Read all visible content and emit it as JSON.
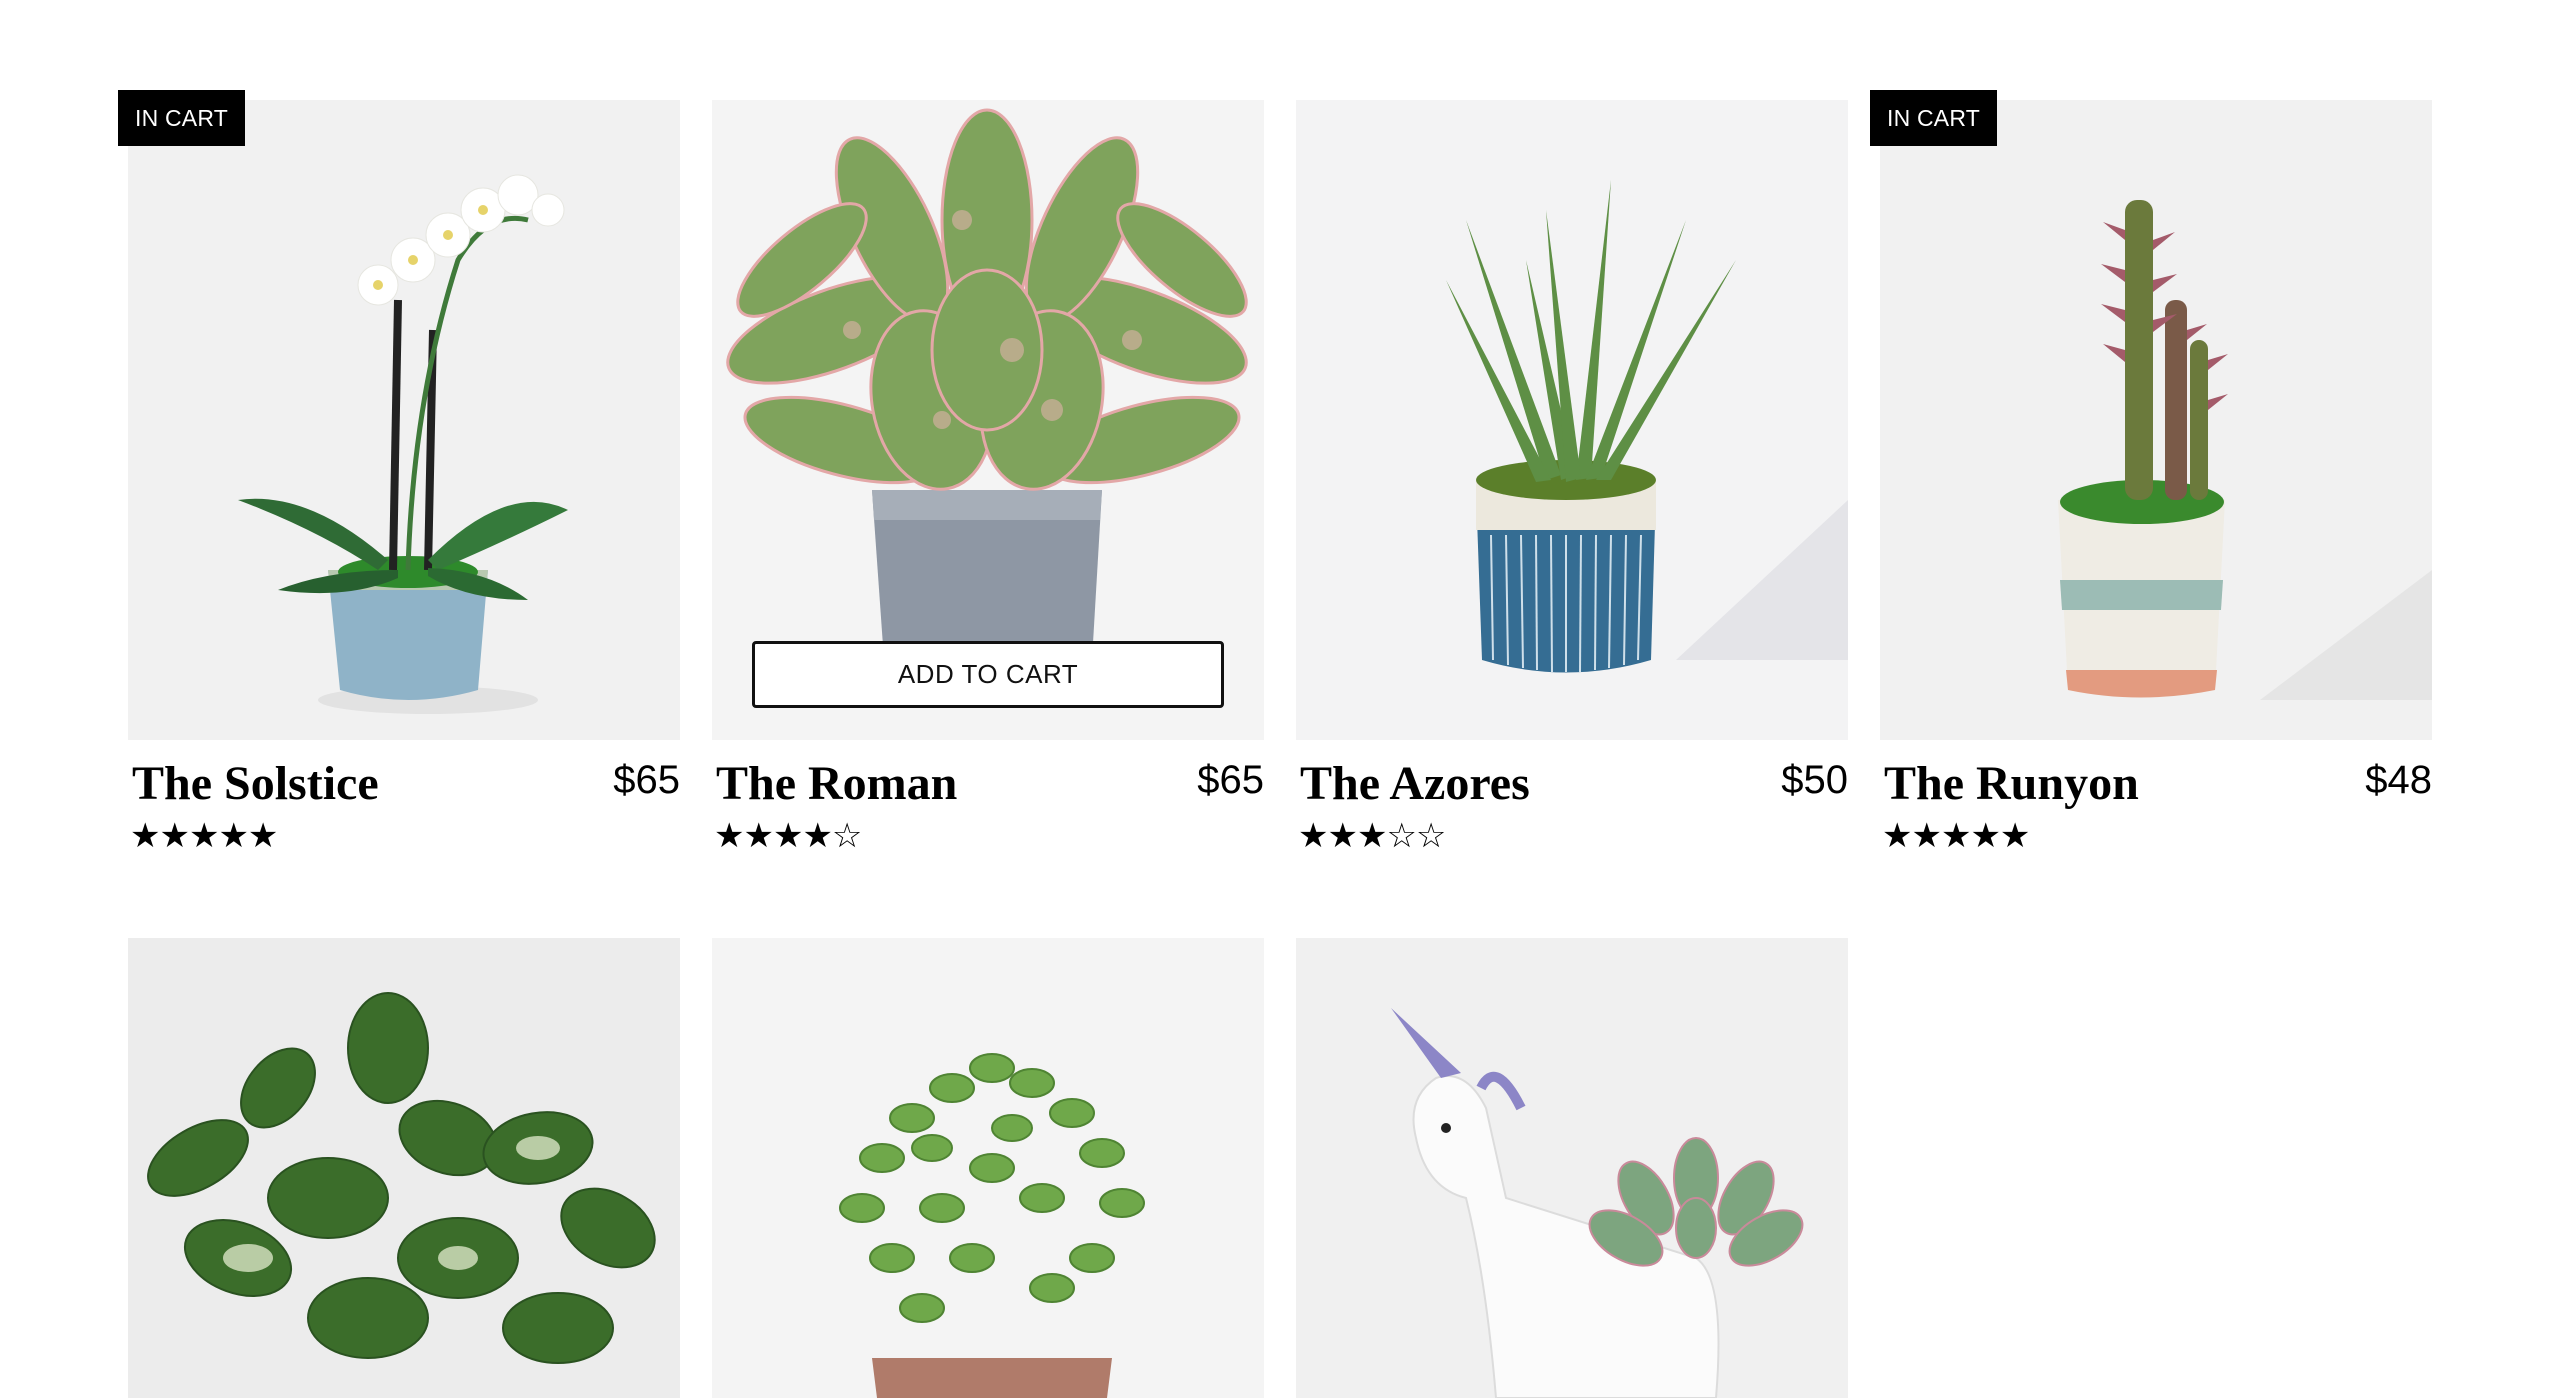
{
  "products": [
    {
      "name": "The Solstice",
      "price": "$65",
      "stars": "★★★★★",
      "badge": "IN CART",
      "image": "white-orchid-blue-pot"
    },
    {
      "name": "The Roman",
      "price": "$65",
      "stars": "★★★★☆",
      "button": "ADD TO CART",
      "image": "pink-aglaonema-grey-pot"
    },
    {
      "name": "The Azores",
      "price": "$50",
      "stars": "★★★☆☆",
      "image": "aloe-blue-striped-pot"
    },
    {
      "name": "The Runyon",
      "price": "$48",
      "stars": "★★★★★",
      "badge": "IN CART",
      "image": "cactus-cream-pot"
    },
    {
      "image": "pothos-plant"
    },
    {
      "image": "jade-succulent"
    },
    {
      "image": "unicorn-succulent-planter"
    }
  ],
  "colors": {
    "badge_bg": "#000000",
    "badge_text": "#ffffff",
    "photo_bg": "#f2f2f2"
  }
}
